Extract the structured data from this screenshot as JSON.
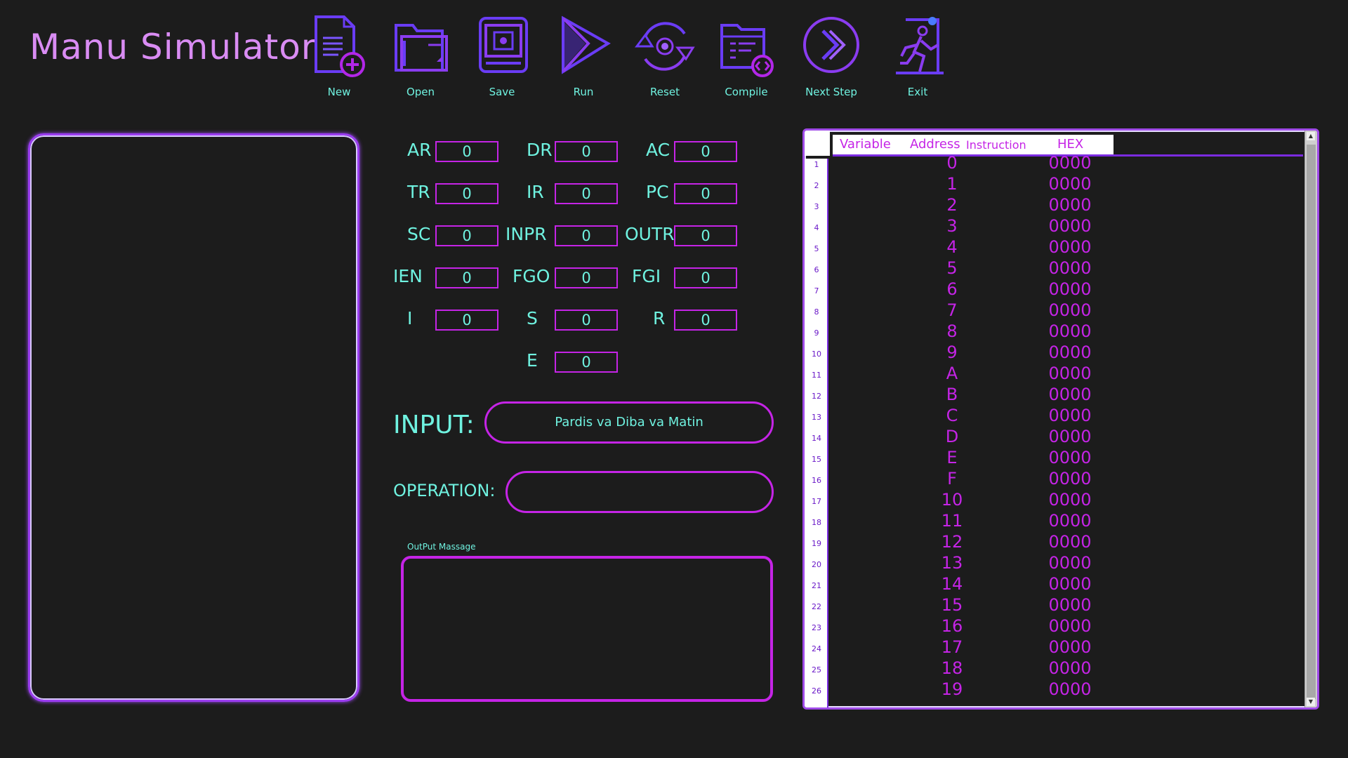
{
  "app": {
    "title": "Manu Simulator"
  },
  "toolbar": {
    "items": [
      {
        "label": "New",
        "icon": "new-file-icon"
      },
      {
        "label": "Open",
        "icon": "open-folder-icon"
      },
      {
        "label": "Save",
        "icon": "save-icon"
      },
      {
        "label": "Run",
        "icon": "play-icon"
      },
      {
        "label": "Reset",
        "icon": "reset-icon"
      },
      {
        "label": "Compile",
        "icon": "compile-icon"
      },
      {
        "label": "Next Step",
        "icon": "next-step-icon"
      },
      {
        "label": "Exit",
        "icon": "exit-icon"
      }
    ]
  },
  "registers": [
    {
      "name": "AR",
      "value": "0"
    },
    {
      "name": "DR",
      "value": "0"
    },
    {
      "name": "AC",
      "value": "0"
    },
    {
      "name": "TR",
      "value": "0"
    },
    {
      "name": "IR",
      "value": "0"
    },
    {
      "name": "PC",
      "value": "0"
    },
    {
      "name": "SC",
      "value": "0"
    },
    {
      "name": "INPR",
      "value": "0"
    },
    {
      "name": "OUTR",
      "value": "0"
    },
    {
      "name": "IEN",
      "value": "0"
    },
    {
      "name": "FGO",
      "value": "0"
    },
    {
      "name": "FGI",
      "value": "0"
    },
    {
      "name": "I",
      "value": "0"
    },
    {
      "name": "S",
      "value": "0"
    },
    {
      "name": "R",
      "value": "0"
    },
    {
      "name": "E",
      "value": "0"
    }
  ],
  "io": {
    "input_label": "INPUT:",
    "input_value": "Pardis va Diba va Matin",
    "operation_label": "OPERATION:",
    "operation_value": "",
    "output_label": "OutPut Massage",
    "output_value": ""
  },
  "memory": {
    "columns": [
      "Variable",
      "Address",
      "Instruction",
      "HEX"
    ],
    "line_numbers": [
      "1",
      "2",
      "3",
      "4",
      "5",
      "6",
      "7",
      "8",
      "9",
      "10",
      "11",
      "12",
      "13",
      "14",
      "15",
      "16",
      "17",
      "18",
      "19",
      "20",
      "21",
      "22",
      "23",
      "24",
      "25",
      "26"
    ],
    "rows": [
      {
        "address": "0",
        "hex": "0000"
      },
      {
        "address": "1",
        "hex": "0000"
      },
      {
        "address": "2",
        "hex": "0000"
      },
      {
        "address": "3",
        "hex": "0000"
      },
      {
        "address": "4",
        "hex": "0000"
      },
      {
        "address": "5",
        "hex": "0000"
      },
      {
        "address": "6",
        "hex": "0000"
      },
      {
        "address": "7",
        "hex": "0000"
      },
      {
        "address": "8",
        "hex": "0000"
      },
      {
        "address": "9",
        "hex": "0000"
      },
      {
        "address": "A",
        "hex": "0000"
      },
      {
        "address": "B",
        "hex": "0000"
      },
      {
        "address": "C",
        "hex": "0000"
      },
      {
        "address": "D",
        "hex": "0000"
      },
      {
        "address": "E",
        "hex": "0000"
      },
      {
        "address": "F",
        "hex": "0000"
      },
      {
        "address": "10",
        "hex": "0000"
      },
      {
        "address": "11",
        "hex": "0000"
      },
      {
        "address": "12",
        "hex": "0000"
      },
      {
        "address": "13",
        "hex": "0000"
      },
      {
        "address": "14",
        "hex": "0000"
      },
      {
        "address": "15",
        "hex": "0000"
      },
      {
        "address": "16",
        "hex": "0000"
      },
      {
        "address": "17",
        "hex": "0000"
      },
      {
        "address": "18",
        "hex": "0000"
      },
      {
        "address": "19",
        "hex": "0000"
      }
    ]
  },
  "colors": {
    "background": "#1c1c1c",
    "accent_magenta": "#c524e6",
    "accent_purple": "#7b2be0",
    "text_cyan": "#6ff2e0",
    "title_pink": "#d98cf3"
  }
}
